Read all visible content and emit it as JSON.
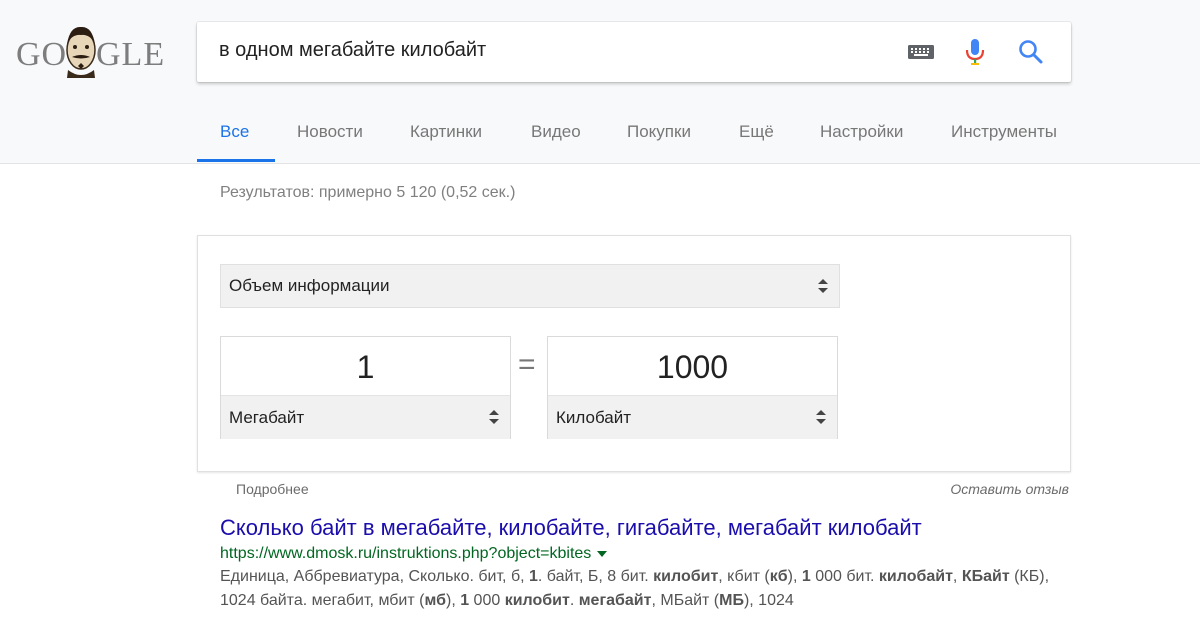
{
  "logo": {
    "left_text": "GO",
    "right_text": "GLE"
  },
  "search": {
    "query": "в одном мегабайте килобайт"
  },
  "icons": {
    "keyboard": "keyboard-icon",
    "mic": "mic-icon",
    "search": "search-icon"
  },
  "tabs": [
    {
      "label": "Все",
      "active": true
    },
    {
      "label": "Новости"
    },
    {
      "label": "Картинки"
    },
    {
      "label": "Видео"
    },
    {
      "label": "Покупки"
    },
    {
      "label": "Ещё"
    },
    {
      "label": "Настройки"
    },
    {
      "label": "Инструменты"
    }
  ],
  "results_stats": "Результатов: примерно 5 120 (0,52 сек.)",
  "converter": {
    "category": "Объем информации",
    "from_value": "1",
    "from_unit": "Мегабайт",
    "equals": "=",
    "to_value": "1000",
    "to_unit": "Килобайт"
  },
  "footer_links": {
    "more": "Подробнее",
    "feedback": "Оставить отзыв"
  },
  "result": {
    "title": "Сколько байт в мегабайте, килобайте, гигабайте, мегабайт килобайт",
    "url": "https://www.dmosk.ru/instruktions.php?object=kbites",
    "snippet_parts": [
      {
        "t": "Единица, Аббревиатура, Сколько. бит, б, "
      },
      {
        "t": "1",
        "b": true
      },
      {
        "t": ". байт, Б, 8 бит. "
      },
      {
        "t": "килобит",
        "b": true
      },
      {
        "t": ", кбит ("
      },
      {
        "t": "кб",
        "b": true
      },
      {
        "t": "), "
      },
      {
        "t": "1",
        "b": true
      },
      {
        "t": " 000 бит. "
      },
      {
        "t": "килобайт",
        "b": true
      },
      {
        "t": ", "
      },
      {
        "t": "КБайт",
        "b": true
      },
      {
        "t": " (КБ), 1024 байта. мегабит, мбит ("
      },
      {
        "t": "мб",
        "b": true
      },
      {
        "t": "), "
      },
      {
        "t": "1",
        "b": true
      },
      {
        "t": " 000 "
      },
      {
        "t": "килобит",
        "b": true
      },
      {
        "t": ". "
      },
      {
        "t": "мегабайт",
        "b": true
      },
      {
        "t": ", МБайт ("
      },
      {
        "t": "МБ",
        "b": true
      },
      {
        "t": "), 1024"
      }
    ]
  },
  "colors": {
    "accent": "#1a73e8",
    "link": "#1a0dab",
    "url": "#006621"
  }
}
